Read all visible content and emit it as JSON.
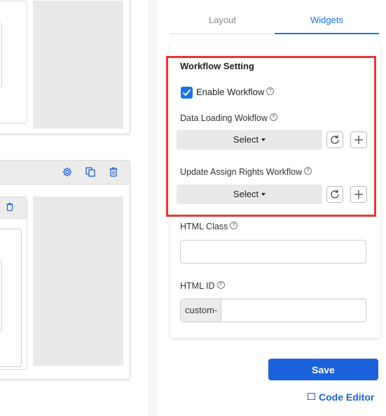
{
  "tabs": [
    {
      "label": "Layout",
      "active": false
    },
    {
      "label": "Widgets",
      "active": true
    }
  ],
  "workflow": {
    "section_title": "Workflow Setting",
    "enable_label": "Enable Workflow",
    "enable_checked": true,
    "data_loading_label": "Data Loading Wokflow",
    "data_loading_select": "Select",
    "update_rights_label": "Update Assign Rights Workflow",
    "update_rights_select": "Select"
  },
  "html_class": {
    "label": "HTML Class",
    "value": ""
  },
  "html_id": {
    "label": "HTML ID",
    "prefix": "custom-",
    "value": ""
  },
  "actions": {
    "save_label": "Save",
    "code_editor_label": "Code Editor"
  },
  "colors": {
    "accent": "#1a62dc",
    "highlight": "#e53935"
  },
  "icons": {
    "box_toolbar": [
      "gear-icon",
      "copy-icon",
      "trash-icon"
    ],
    "select_actions": [
      "refresh-icon",
      "plus-icon"
    ],
    "code_editor": "terminal-icon"
  }
}
